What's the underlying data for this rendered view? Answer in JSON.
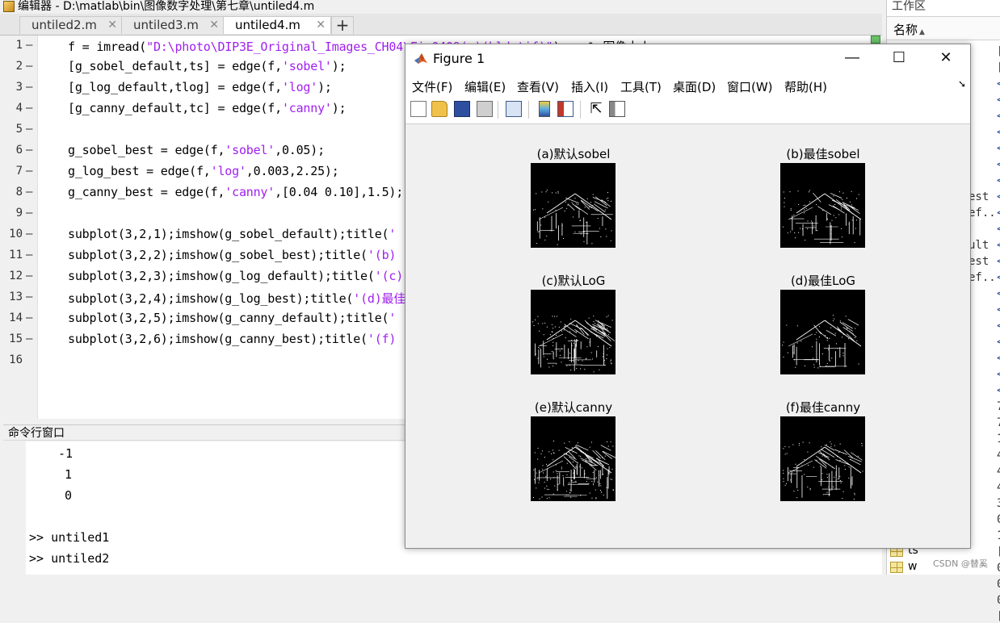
{
  "editor": {
    "title": "编辑器 - D:\\matlab\\bin\\图像数字处理\\第七章\\untiled4.m",
    "tabs": [
      {
        "label": "untiled2.m"
      },
      {
        "label": "untiled3.m"
      },
      {
        "label": "untiled4.m"
      }
    ],
    "lines": [
      {
        "n": "1",
        "parts": [
          "f = imread(",
          "\"D:\\photo\\DIP3E_Original_Images_CH04\\Fig0409(a)(bld.tif)\"",
          ");   % 图像大小 ..."
        ]
      },
      {
        "n": "2",
        "parts": [
          "[g_sobel_default,ts] = edge(f,",
          "'sobel'",
          ");"
        ]
      },
      {
        "n": "3",
        "parts": [
          "[g_log_default,tlog] = edge(f,",
          "'log'",
          ");"
        ]
      },
      {
        "n": "4",
        "parts": [
          "[g_canny_default,tc] = edge(f,",
          "'canny'",
          ");"
        ]
      },
      {
        "n": "5",
        "parts": [
          "",
          "",
          ""
        ]
      },
      {
        "n": "6",
        "parts": [
          "g_sobel_best = edge(f,",
          "'sobel'",
          ",0.05);"
        ]
      },
      {
        "n": "7",
        "parts": [
          "g_log_best = edge(f,",
          "'log'",
          ",0.003,2.25);"
        ]
      },
      {
        "n": "8",
        "parts": [
          "g_canny_best = edge(f,",
          "'canny'",
          ",[0.04 0.10],1.5);"
        ]
      },
      {
        "n": "9",
        "parts": [
          "",
          "",
          ""
        ]
      },
      {
        "n": "10",
        "parts": [
          "subplot(3,2,1);imshow(g_sobel_default);title(",
          "'",
          ""
        ]
      },
      {
        "n": "11",
        "parts": [
          "subplot(3,2,2);imshow(g_sobel_best);title(",
          "'(b)",
          ""
        ]
      },
      {
        "n": "12",
        "parts": [
          "subplot(3,2,3);imshow(g_log_default);title(",
          "'(c)",
          ""
        ]
      },
      {
        "n": "13",
        "parts": [
          "subplot(3,2,4);imshow(g_log_best);title(",
          "'(d)最佳",
          ""
        ]
      },
      {
        "n": "14",
        "parts": [
          "subplot(3,2,5);imshow(g_canny_default);title(",
          "'",
          ""
        ]
      },
      {
        "n": "15",
        "parts": [
          "subplot(3,2,6);imshow(g_canny_best);title(",
          "'(f)",
          ""
        ]
      },
      {
        "n": "16",
        "parts": [
          "",
          "",
          ""
        ]
      }
    ]
  },
  "command_window": {
    "header": "命令行窗口",
    "outputs": [
      "-1",
      "1",
      "0"
    ],
    "commands": [
      ">> untiled1",
      ">> untiled2"
    ]
  },
  "workspace": {
    "title": "工作区",
    "name_header": "名称",
    "sort_indicator": "▲",
    "name_fragments": [
      "est",
      "ef...",
      "ult",
      "est",
      "ef..."
    ],
    "value_fragments": [
      "[",
      "[",
      "<",
      "<",
      "<",
      "<",
      "<",
      "<",
      "<",
      "<",
      "<",
      "<",
      "<",
      "<",
      "<",
      "<",
      "<",
      "<",
      "<",
      "<",
      "<",
      "<",
      "7",
      "7",
      "1",
      "4",
      "4",
      "4",
      "3",
      "0",
      "1",
      "[",
      "0",
      "0",
      "0",
      "["
    ],
    "variables": [
      "ts",
      "w"
    ]
  },
  "figure": {
    "title": "Figure 1",
    "menus": [
      "文件(F)",
      "编辑(E)",
      "查看(V)",
      "插入(I)",
      "工具(T)",
      "桌面(D)",
      "窗口(W)",
      "帮助(H)"
    ],
    "toolbar_icons": [
      "new-figure-icon",
      "open-file-icon",
      "save-icon",
      "print-icon",
      "link-plot-icon",
      "colorbar-icon",
      "legend-icon",
      "pointer-icon",
      "property-editor-icon"
    ],
    "subplots": [
      {
        "title": "(a)默认sobel",
        "seed": 11,
        "density": 0.55
      },
      {
        "title": "(b)最佳sobel",
        "seed": 23,
        "density": 0.6
      },
      {
        "title": "(c)默认LoG",
        "seed": 37,
        "density": 1.0
      },
      {
        "title": "(d)最佳LoG",
        "seed": 41,
        "density": 0.5
      },
      {
        "title": "(e)默认canny",
        "seed": 53,
        "density": 1.1
      },
      {
        "title": "(f)最佳canny",
        "seed": 67,
        "density": 0.7
      }
    ]
  },
  "watermark": "CSDN @替奚"
}
